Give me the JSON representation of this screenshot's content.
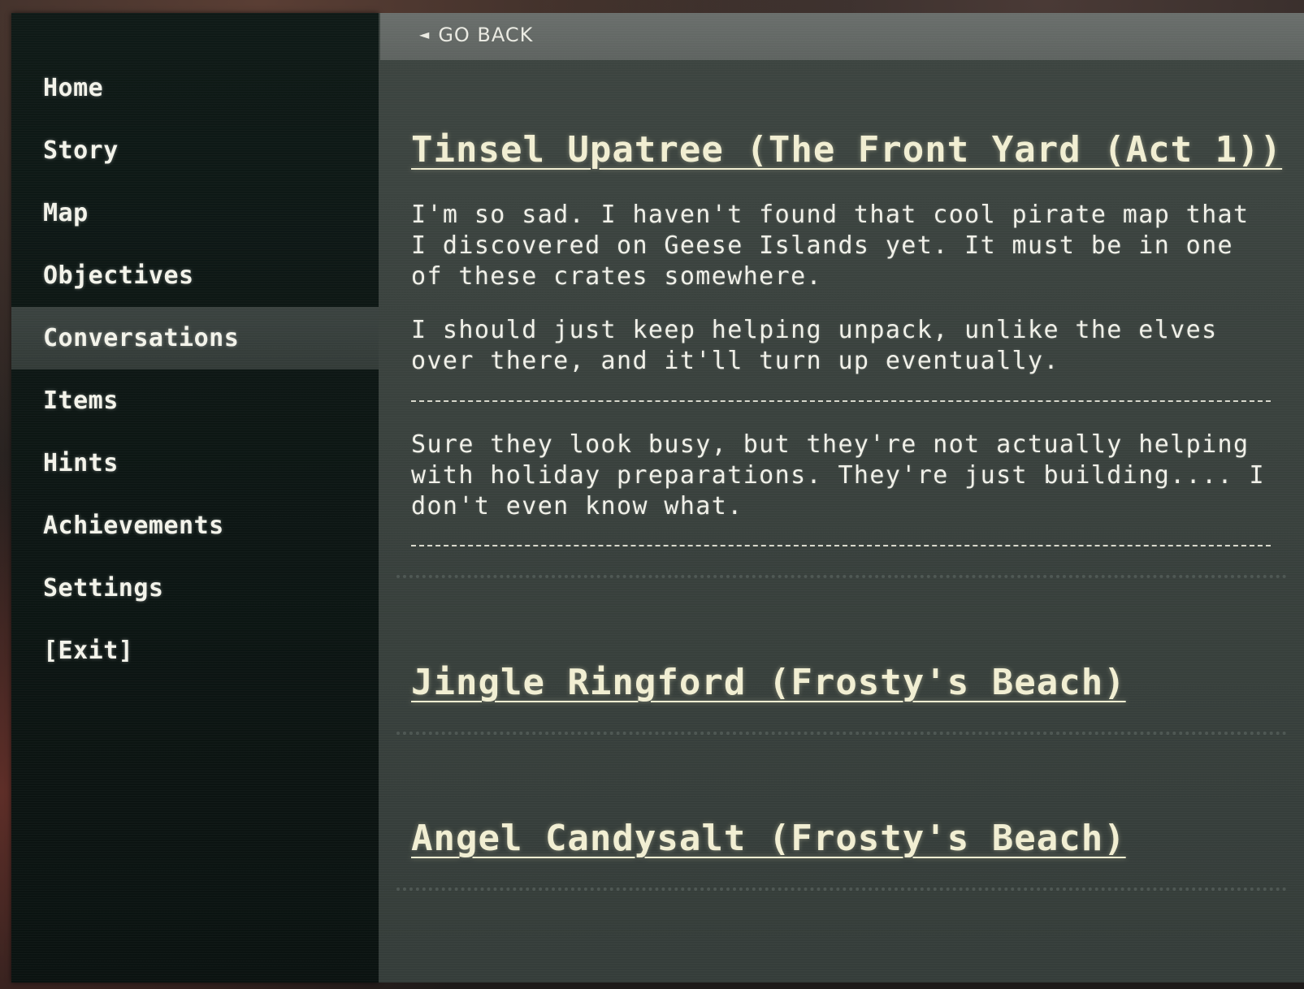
{
  "sidebar": {
    "items": [
      {
        "label": "Home",
        "active": false
      },
      {
        "label": "Story",
        "active": false
      },
      {
        "label": "Map",
        "active": false
      },
      {
        "label": "Objectives",
        "active": false
      },
      {
        "label": "Conversations",
        "active": true
      },
      {
        "label": "Items",
        "active": false
      },
      {
        "label": "Hints",
        "active": false
      },
      {
        "label": "Achievements",
        "active": false
      },
      {
        "label": "Settings",
        "active": false
      },
      {
        "label": "[Exit]",
        "active": false
      }
    ]
  },
  "topbar": {
    "back_arrow": "◄",
    "back_label": "GO BACK"
  },
  "conversations": [
    {
      "title": "Tinsel Upatree (The Front Yard (Act 1))",
      "paragraphs": [
        "I'm so sad. I haven't found that cool pirate map that I discovered on Geese Islands yet. It must be in one of these crates somewhere.",
        "I should just keep helping unpack, unlike the elves over there, and it'll turn up eventually.",
        "Sure they look busy, but they're not actually helping with holiday preparations. They're just building.... I don't even know what."
      ]
    },
    {
      "title": "Jingle Ringford (Frosty's Beach)",
      "paragraphs": []
    },
    {
      "title": "Angel Candysalt (Frosty's Beach)",
      "paragraphs": []
    }
  ],
  "colors": {
    "sidebar_bg": "#0f1a17",
    "active_item_bg": "#3b4340",
    "main_bg": "#3d4541",
    "title_text": "#f1eed2",
    "body_text": "#f0f0e8"
  }
}
